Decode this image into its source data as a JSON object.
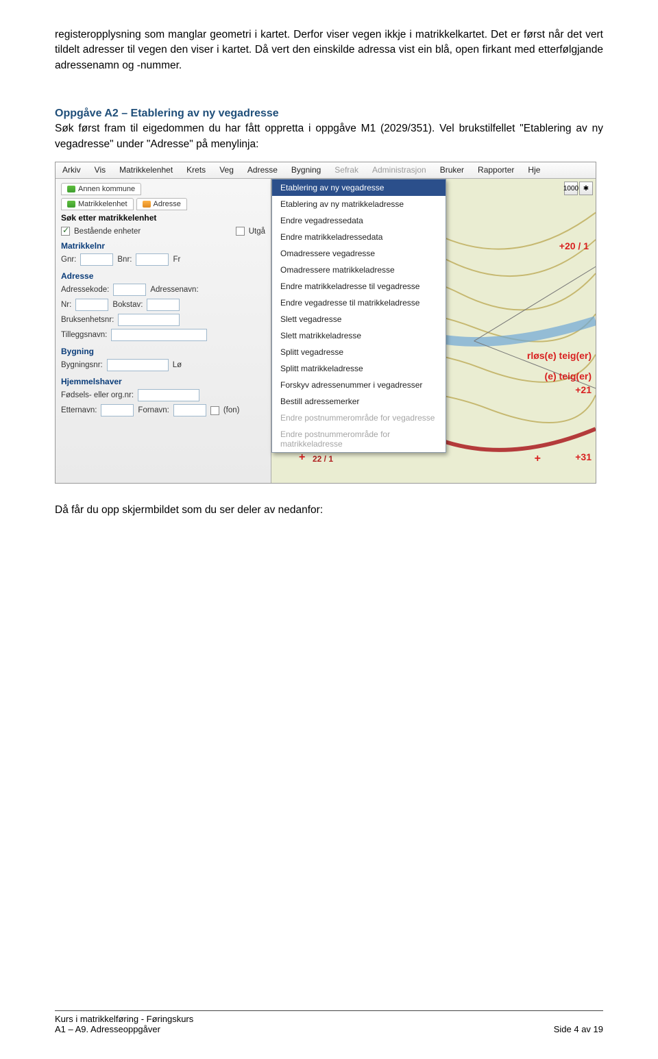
{
  "intro": "registeropplysning som manglar geometri i kartet. Derfor viser vegen ikkje i matrikkelkartet. Det er først når det vert tildelt adresser til vegen den viser i kartet. Då vert den einskilde adressa vist ein blå, open firkant med etterfølgjande adressenamn og -nummer.",
  "section": {
    "heading": "Oppgåve A2 – Etablering av ny vegadresse",
    "body": "Søk først fram til eigedommen du har fått oppretta i oppgåve M1 (2029/351). Vel brukstilfellet \"Etablering av ny vegadresse\" under \"Adresse\" på menylinja:"
  },
  "screenshot": {
    "menubar": [
      "Arkiv",
      "Vis",
      "Matrikkelenhet",
      "Krets",
      "Veg",
      "Adresse",
      "Bygning",
      "Sefrak",
      "Administrasjon",
      "Bruker",
      "Rapporter",
      "Hje"
    ],
    "menubar_disabled": [
      "Sefrak",
      "Administrasjon"
    ],
    "tabs": {
      "annen": "Annen kommune",
      "matrikkel": "Matrikkelenhet",
      "adresse": "Adresse"
    },
    "panel_title": "Søk etter matrikkelenhet",
    "checkbox_bestaaende": "Bestående enheter",
    "checkbox_utga": "Utgå",
    "groups": {
      "matrikkelnr": "Matrikkelnr",
      "adresse": "Adresse",
      "bygning": "Bygning",
      "hjemmelshaver": "Hjemmelshaver"
    },
    "labels": {
      "gnr": "Gnr:",
      "bnr": "Bnr:",
      "fr": "Fr",
      "adressekode": "Adressekode:",
      "adressenavn": "Adressenavn:",
      "nr": "Nr:",
      "bokstav": "Bokstav:",
      "bruksenhetsnr": "Bruksenhetsnr:",
      "tilleggsnavn": "Tilleggsnavn:",
      "bygningsnr": "Bygningsnr:",
      "lo": "Lø",
      "fodsels_org": "Fødsels- eller org.nr:",
      "etternavn": "Etternavn:",
      "fornavn": "Fornavn:",
      "fon": "(fon)"
    },
    "dropdown": [
      "Etablering av ny vegadresse",
      "Etablering av ny matrikkeladresse",
      "Endre vegadressedata",
      "Endre matrikkeladressedata",
      "Omadressere vegadresse",
      "Omadressere matrikkeladresse",
      "Endre matrikkeladresse til vegadresse",
      "Endre vegadresse til matrikkeladresse",
      "Slett vegadresse",
      "Slett matrikkeladresse",
      "Splitt vegadresse",
      "Splitt matrikkeladresse",
      "Forskyv adressenummer i vegadresser",
      "Bestill adressemerker",
      "Endre postnummerområde for vegadresse",
      "Endre postnummerområde for matrikkeladresse"
    ],
    "dropdown_selected": "Etablering av ny vegadresse",
    "dropdown_disabled": [
      "Endre postnummerområde for vegadresse",
      "Endre postnummerområde for matrikkeladresse"
    ],
    "map_labels": {
      "a": "+20 / 1",
      "b": "rløs(e) teig(er)",
      "c": "(e) teig(er)",
      "d": "+21",
      "e": "+31",
      "num22": "22 / 1"
    },
    "map_tool": "1000"
  },
  "after_shot": "Då får du opp skjermbildet som du ser deler av nedanfor:",
  "footer": {
    "line1": "Kurs i matrikkelføring - Føringskurs",
    "line2": "A1 – A9. Adresseoppgåver",
    "page": "Side 4 av 19"
  }
}
